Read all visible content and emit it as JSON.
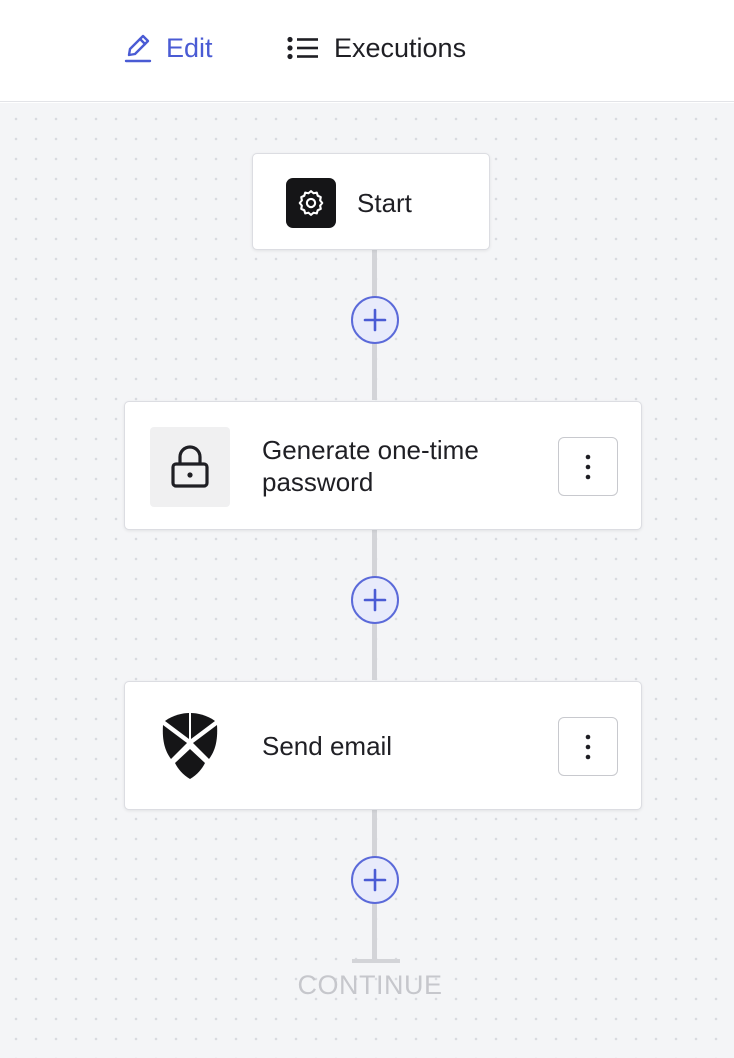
{
  "tabs": {
    "edit_label": "Edit",
    "executions_label": "Executions",
    "active": "edit",
    "active_color": "#4a5bd4"
  },
  "flow": {
    "start": {
      "label": "Start",
      "icon": "gear-icon"
    },
    "steps": [
      {
        "label": "Generate one-time password",
        "icon": "lock-icon"
      },
      {
        "label": "Send email",
        "icon": "shield-logo-icon"
      }
    ],
    "add_step_icon": "plus-icon",
    "step_menu_icon": "vertical-ellipsis-icon",
    "end_label": "CONTINUE"
  }
}
